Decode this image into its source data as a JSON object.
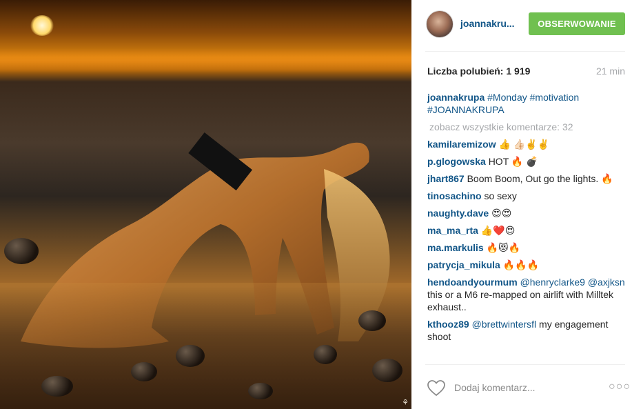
{
  "post": {
    "watermark": "❗",
    "username": "joannakru...",
    "follow_label": "OBSERWOWANIE",
    "likes": "Liczba polubień: 1 919",
    "time": "21 min",
    "caption_user": "joannakrupa",
    "caption_tags": "#Monday #motivation #JOANNAKRUPA",
    "see_all": "zobacz wszystkie komentarze: 32",
    "add_comment_placeholder": "Dodaj komentarz...",
    "more_label": "○○○"
  },
  "comments": [
    {
      "user": "kamilaremizow",
      "text": "👍 👍🏻✌️✌️"
    },
    {
      "user": "p.glogowska",
      "text": "HOT 🔥 💣"
    },
    {
      "user": "jhart867",
      "text": "Boom Boom, Out go the lights. 🔥"
    },
    {
      "user": "tinosachino",
      "text": "so sexy"
    },
    {
      "user": "naughty.dave",
      "text": "😍😍"
    },
    {
      "user": "ma_ma_rta",
      "text": "👍❤️😍"
    },
    {
      "user": "ma.markulis",
      "text": "🔥😻🔥"
    },
    {
      "user": "patrycja_mikula",
      "text": "🔥🔥🔥"
    },
    {
      "user": "hendoandyourmum",
      "mention": "@henryclarke9 @axjksn",
      "text": " this or a M6 re-mapped on airlift with Milltek exhaust.."
    },
    {
      "user": "kthooz89",
      "mention": "@brettwintersfl",
      "text": " my engagement shoot"
    }
  ],
  "colors": {
    "link": "#125688",
    "follow_button": "#70c050",
    "muted": "#a5a7aa"
  }
}
